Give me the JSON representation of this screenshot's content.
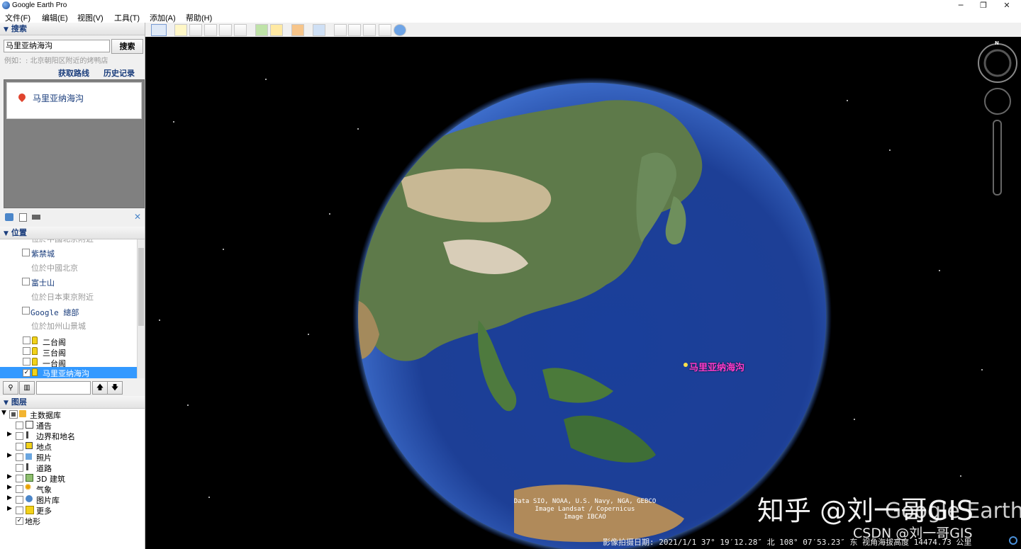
{
  "window": {
    "title": "Google Earth Pro",
    "btn_min": "─",
    "btn_max": "❐",
    "btn_close": "✕"
  },
  "menu": [
    "文件(F)",
    "编辑(E)",
    "视图(V)",
    "工具(T)",
    "添加(A)",
    "帮助(H)"
  ],
  "search": {
    "header": "搜索",
    "value": "马里亚纳海沟",
    "button": "搜索",
    "hint": "例如：: 北京朝阳区附近的烤鸭店",
    "link_route": "获取路线",
    "link_history": "历史记录",
    "result": "马里亚纳海沟"
  },
  "places": {
    "header": "位置",
    "items": [
      {
        "name": "紫禁城",
        "desc": "位於中國北京"
      },
      {
        "name": "富士山",
        "desc": "位於日本東京附近"
      },
      {
        "name": "Google  總部",
        "desc": "位於加州山景城"
      }
    ],
    "pins": [
      "二台阁",
      "三台阁",
      "一台阁"
    ],
    "selected": "马里亚纳海沟"
  },
  "layers": {
    "header": "图层",
    "root": "主数据库",
    "items": [
      "通告",
      "边界和地名",
      "地点",
      "照片",
      "道路",
      "3D 建筑",
      "气象",
      "图片库",
      "更多"
    ],
    "terrain": "地形"
  },
  "map": {
    "place_label": "马里亚纳海沟",
    "attribution": [
      "Data SIO, NOAA, U.S. Navy, NGA, GEBCO",
      "Image Landsat / Copernicus",
      "Image IBCAO"
    ],
    "status": "影像拍摄日期: 2021/1/1   37° 19′12.28″ 北 108° 07′53.23″ 东  视角海拔高度 14474.73 公里",
    "compass_n": "N",
    "watermark_zhihu": "知乎 @刘一哥GIS",
    "watermark_ge": "Google Earth",
    "watermark_csdn": "CSDN @刘一哥GIS"
  },
  "colors": {
    "accent": "#1a3d7c",
    "selection": "#3399ff",
    "label_pink": "#ff3dd2"
  }
}
